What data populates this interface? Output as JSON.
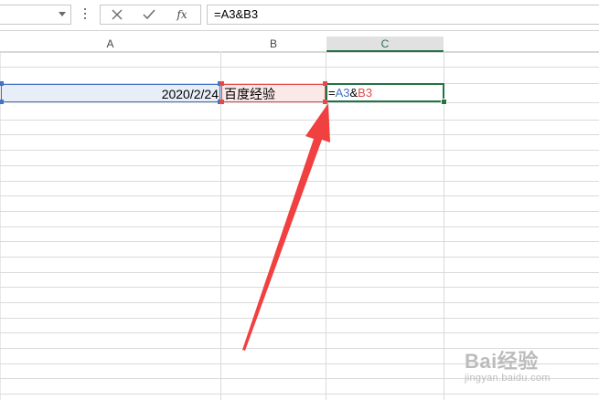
{
  "formula_bar": {
    "name_box_value": "",
    "formula": "=A3&B3",
    "fx_label": "fx",
    "cancel_icon": "x-icon",
    "enter_icon": "check-icon"
  },
  "columns": [
    {
      "label": "A"
    },
    {
      "label": "B"
    },
    {
      "label": "C"
    }
  ],
  "cells": {
    "a3": "2020/2/24",
    "b3": "百度经验",
    "c3_prefix": "=",
    "c3_ref1": "A3",
    "c3_op": "&",
    "c3_ref2": "B3"
  },
  "colors": {
    "ref_a_blue": "#4472c4",
    "ref_b_red": "#e24b4b",
    "active_green": "#217346",
    "arrow_red": "#f04040"
  },
  "watermark": {
    "logo": "Bai经验",
    "sub": "jingyan.baidu.com"
  }
}
